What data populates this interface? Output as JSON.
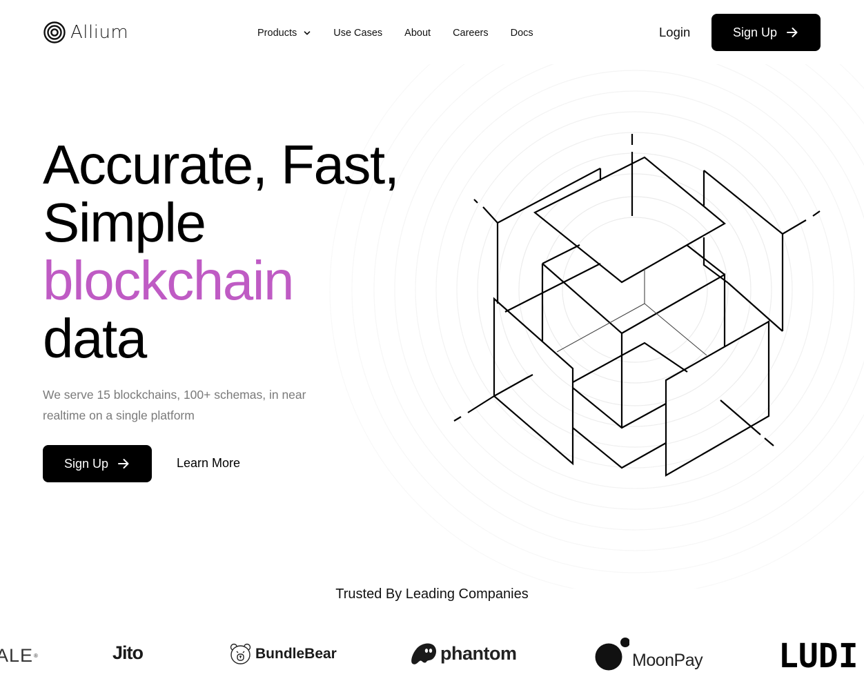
{
  "brand": {
    "name": "Allium",
    "logo_icon": "concentric-rings-logo"
  },
  "nav": {
    "items": [
      {
        "label": "Products",
        "has_dropdown": true,
        "icon": "chevron-down-icon"
      },
      {
        "label": "Use Cases"
      },
      {
        "label": "About"
      },
      {
        "label": "Careers"
      },
      {
        "label": "Docs"
      }
    ],
    "login_label": "Login",
    "signup_label": "Sign Up",
    "signup_icon": "arrow-right-icon"
  },
  "hero": {
    "title_lines": [
      "Accurate, Fast,",
      "Simple"
    ],
    "title_accent": "blockchain",
    "title_end": "data",
    "subtitle": "We serve 15 blockchains, 100+ schemas, in near realtime on a single platform",
    "primary_cta": "Sign Up",
    "secondary_cta": "Learn More",
    "illustration": "isometric-exploded-cube",
    "colors": {
      "accent": "#bf5bc4",
      "text": "#000000",
      "muted": "#7a7a7a"
    }
  },
  "trusted": {
    "title": "Trusted By Leading Companies",
    "logos": [
      {
        "name": "SCALE",
        "visible_text": "ALE",
        "suffix": "®"
      },
      {
        "name": "Jito",
        "visible_text": "Jito"
      },
      {
        "name": "BundleBear",
        "visible_text": "BundleBear",
        "icon": "bear-face-icon"
      },
      {
        "name": "phantom",
        "visible_text": "phantom",
        "icon": "ghost-icon"
      },
      {
        "name": "MoonPay",
        "visible_text": "MoonPay",
        "icon": "moon-dots-icon"
      },
      {
        "name": "LUDI",
        "visible_text": "LUDI"
      }
    ]
  }
}
